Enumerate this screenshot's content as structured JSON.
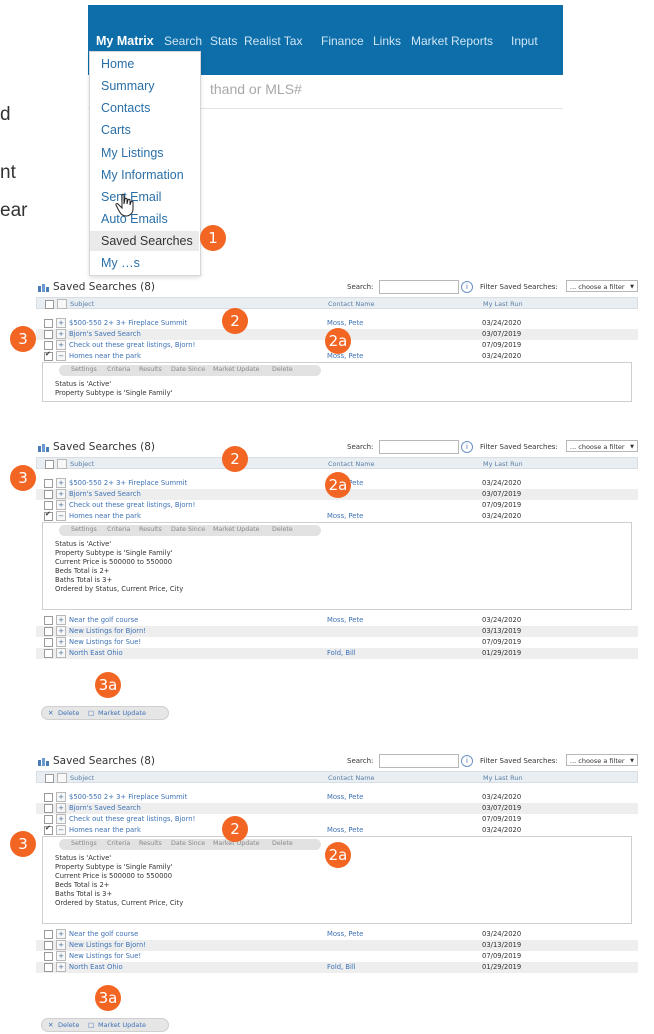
{
  "side_text": [
    "d",
    "nt",
    "ear"
  ],
  "nav": {
    "items": [
      "My Matrix",
      "Search",
      "Stats",
      "Realist Tax",
      "Finance",
      "Links",
      "Market Reports",
      "Input"
    ],
    "search_placeholder": "thand or MLS#"
  },
  "menu": {
    "items": [
      "Home",
      "Summary",
      "Contacts",
      "Carts",
      "My Listings",
      "My Information",
      "Sent Email",
      "Auto Emails",
      "Saved Searches",
      "My …s"
    ]
  },
  "badges": {
    "b1": "1",
    "b2": "2",
    "b2a": "2a",
    "b3": "3",
    "b3a": "3a"
  },
  "panel": {
    "title": "Saved Searches (8)",
    "search_label": "Search:",
    "info": "i",
    "filter_label": "Filter Saved Searches:",
    "filter_value": "... choose a filter",
    "col_subject": "Subject",
    "col_contact": "Contact Name",
    "col_lastrun": "My Last Run",
    "rows_top": [
      {
        "subject": "$500-550 2+ 3+ Fireplace Summit",
        "contact": "Moss, Pete",
        "date": "03/24/2020"
      },
      {
        "subject": "Bjorn's Saved Search",
        "contact": "",
        "date": "03/07/2019"
      },
      {
        "subject": "Check out these great listings, Bjorn!",
        "contact": "",
        "date": "07/09/2019"
      },
      {
        "subject": "Homes near the park",
        "contact": "Moss, Pete",
        "date": "03/24/2020"
      }
    ],
    "rows_bottom": [
      {
        "subject": "Near the golf course",
        "contact": "Moss, Pete",
        "date": "03/24/2020"
      },
      {
        "subject": "New Listings for Bjorn!",
        "contact": "",
        "date": "03/13/2019"
      },
      {
        "subject": "New Listings for Sue!",
        "contact": "",
        "date": "07/09/2019"
      },
      {
        "subject": "North East Ohio",
        "contact": "Fold, Bill",
        "date": "01/29/2019"
      }
    ],
    "actions": [
      "Settings",
      "Criteria",
      "Results",
      "Date Since",
      "Market Update",
      "Delete"
    ],
    "criteria": [
      "Status is 'Active'",
      "Property Subtype is 'Single Family'",
      "Current Price is 500000 to 550000",
      "Beds Total is 2+",
      "Baths Total is 3+",
      "Ordered by Status, Current Price, City"
    ],
    "btn_delete": "Delete",
    "btn_market": "Market Update"
  }
}
